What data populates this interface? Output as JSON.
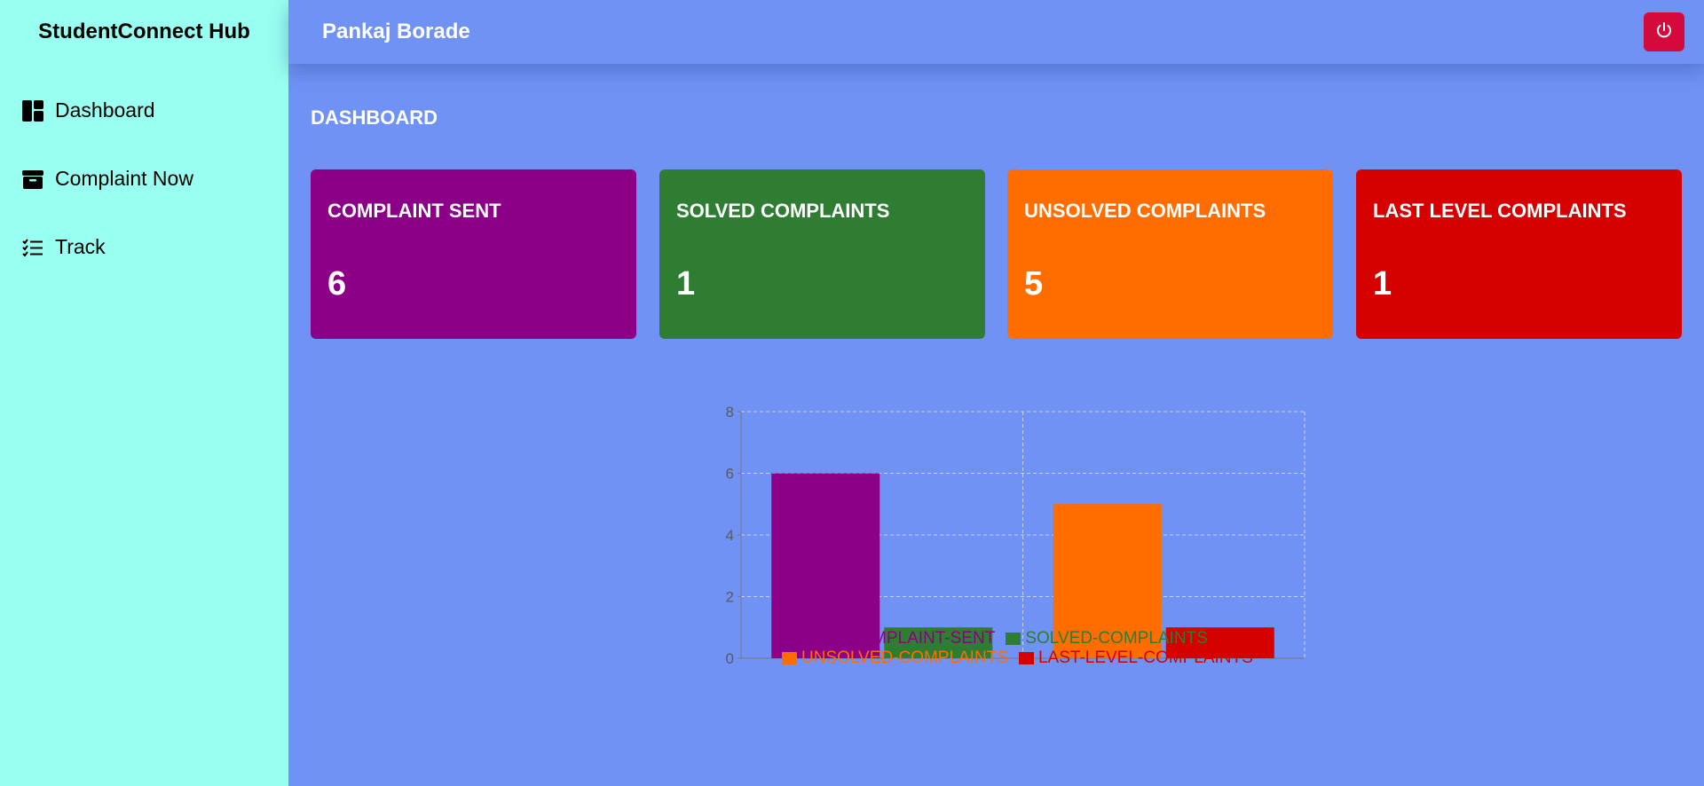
{
  "sidebar": {
    "brand": "StudentConnect Hub",
    "items": [
      {
        "label": "Dashboard",
        "icon": "dashboard-icon"
      },
      {
        "label": "Complaint Now",
        "icon": "archive-box-icon"
      },
      {
        "label": "Track",
        "icon": "checklist-icon"
      }
    ]
  },
  "header": {
    "user_name": "Pankaj Borade",
    "power_icon": "power-icon",
    "power_color": "#d30a3b"
  },
  "main": {
    "title": "DASHBOARD",
    "cards": [
      {
        "label": "COMPLAINT SENT",
        "value": "6",
        "color": "#8b0087"
      },
      {
        "label": "SOLVED COMPLAINTS",
        "value": "1",
        "color": "#2e7d32"
      },
      {
        "label": "UNSOLVED COMPLAINTS",
        "value": "5",
        "color": "#ff6d00"
      },
      {
        "label": "LAST LEVEL COMPLAINTS",
        "value": "1",
        "color": "#d50000"
      }
    ]
  },
  "chart_data": {
    "type": "bar",
    "categories": [
      "",
      ""
    ],
    "ylim": [
      0,
      8
    ],
    "yticks": [
      "0",
      "2",
      "4",
      "6",
      "8"
    ],
    "grid": true,
    "legend": "bottom",
    "series": [
      {
        "name": "COMPLAINT-SENT",
        "values": [
          6,
          null
        ],
        "color": "#8b0087"
      },
      {
        "name": "SOLVED-COMPLAINTS",
        "values": [
          1,
          null
        ],
        "color": "#2e7d32"
      },
      {
        "name": "UNSOLVED-COMPLAINTS",
        "values": [
          null,
          5
        ],
        "color": "#ff6d00"
      },
      {
        "name": "LAST-LEVEL-COMPLAINTS",
        "values": [
          null,
          1
        ],
        "color": "#d50000"
      }
    ]
  }
}
